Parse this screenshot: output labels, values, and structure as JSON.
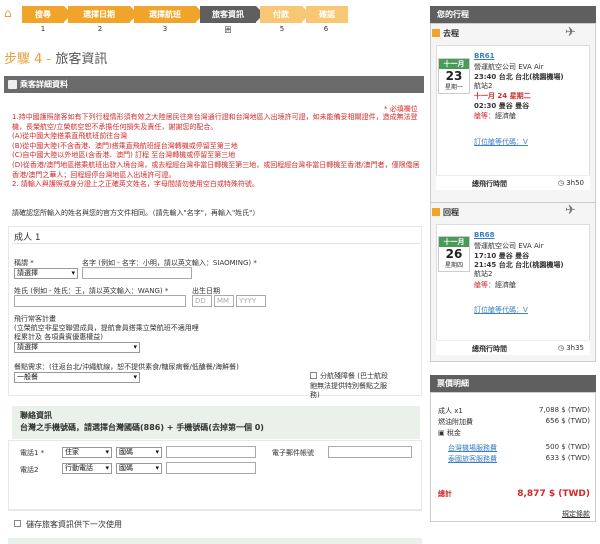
{
  "steps": [
    {
      "label": "搜尋",
      "num": "1"
    },
    {
      "label": "選擇日期",
      "num": "2"
    },
    {
      "label": "選擇航班",
      "num": "3"
    },
    {
      "label": "旅客資訊",
      "num": "囲"
    },
    {
      "label": "付款",
      "num": "5"
    },
    {
      "label": "確認",
      "num": "6"
    }
  ],
  "page_title_step": "步驟 4 -",
  "page_title": "旅客資訊",
  "passenger_panel": {
    "title": "乘客詳細資料",
    "required_note": "* 必填欄位",
    "notice": [
      "1.持中國護照旅客如有下列行程情形須有效之大陸居民往來台灣通行證和台灣地區入出境許可證，如未能備妥相關證件，造成無法登機，長榮航空/立榮航空恕不承擔任何損失及責任，謝謝您的配合。",
      "(A)從中國大陸搭乘直飛航班前往台灣",
      "(B)從中國大陸(不含香港、澳門)搭乘直飛航班經台灣轉機或停留至第三地",
      "(C)自中國大陸以外地區(含香港、澳門) 訂程 至台灣轉機或停留至第三地",
      "(D)從香港/澳門地區搭乘航班出發入境台灣，或去程經台灣非當日轉機至第三地，或回程經台灣非當日轉機至香港/澳門者，僅限僑居香港/澳門之華人；回程經停台灣地區入出境許可證。",
      "2. 請輸入與護照或身分證上之正確英文姓名，字母間請勿使用空白或特殊符號。"
    ],
    "name_hint": "請確認您所輸入的姓名與您的官方文件相同。（請先輸入\"名字\"，再輸入\"姓氏\"）",
    "adult_label": "成人 1",
    "title_label": "稱謂 *",
    "title_value": "請選擇",
    "first_name_label": "名字 (例如 - 名字：小明，請以英文輸入：SIAOMING) *",
    "last_name_label": "姓氏 (例如 - 姓氏：王，請以英文輸入：WANG) *",
    "dob_label": "出生日期",
    "dob_dd": "DD",
    "dob_mm": "MM",
    "dob_yyyy": "YYYY",
    "ffp_label_1": "飛行常客計畫",
    "ffp_label_2": "(立榮航空非星空聯盟成員，提航會員搭乘立榮航班不適用哩",
    "ffp_label_3": "程累計及 各項貴賓優惠權益)",
    "ffp_value": "請選擇",
    "meal_label": "餐點需求：(往返台北/沖繩航線，恕不提供素食/糖尿病餐/低醣餐/海鮮餐)",
    "meal_value": "一般餐",
    "disability_label_1": "分航殘障餐 (巴士航段",
    "disability_label_2": "飽無法提供特別餐點之服",
    "disability_label_3": "務)",
    "contact_title": "聯絡資訊",
    "contact_sub": "台灣之手機號碼，請選擇台灣國碼(886) + 手機號碼(去掉第一個 0)",
    "phone1_label": "電話1 *",
    "phone1_type": "住家",
    "phone1_country": "國碼",
    "phone2_label": "電話2",
    "phone2_type": "行動電話",
    "phone2_country": "國碼",
    "email_label": "電子郵件帳號",
    "save_label": "儲存旅客資訊供下一次使用"
  },
  "itinerary": {
    "title": "您的行程",
    "outbound": {
      "label": "去程",
      "month": "十一月",
      "day": "23",
      "weekday": "星期一",
      "flight": "BR61",
      "airline": "營運航空公司 EVA Air",
      "dep": "23:40 台北 台北(桃園機場)",
      "terminal": "航站2",
      "next_date": "十一月 24 星期二",
      "arr": "02:30 曼谷 曼谷",
      "cabin_label": "艙等：",
      "cabin": "經濟艙",
      "fare_link": "訂位艙等代碼：V",
      "duration_label": "總飛行時間",
      "duration": "3h50"
    },
    "inbound": {
      "label": "回程",
      "month": "十一月",
      "day": "26",
      "weekday": "星期四",
      "flight": "BR68",
      "airline": "營運航空公司 EVA Air",
      "dep": "17:10 曼谷 曼谷",
      "arr": "21:45 台北 台北(桃園機場)",
      "terminal": "航站2",
      "cabin_label": "艙等：",
      "cabin": "經濟艙",
      "fare_link": "訂位艙等代碼：V",
      "duration_label": "總飛行時間",
      "duration": "3h35"
    }
  },
  "price": {
    "title": "票價明細",
    "adult_label": "成人 x1",
    "adult_value": "7,088 $ (TWD)",
    "fuel_label": "燃油附加費",
    "fuel_value": "656 $ (TWD)",
    "tax_label": "稅金",
    "tax1_label": "台灣機場服務費",
    "tax1_value": "500 $ (TWD)",
    "tax2_label": "泰國旅客服務費",
    "tax2_value": "633 $ (TWD)",
    "total_label": "總計",
    "total_value": "8,877 $ (TWD)",
    "fare_rules": "規定條款"
  },
  "colors": {
    "accent": "#f0a42a",
    "header": "#5f5f5f",
    "required": "#d12b2b",
    "link": "#3b7fc4"
  }
}
